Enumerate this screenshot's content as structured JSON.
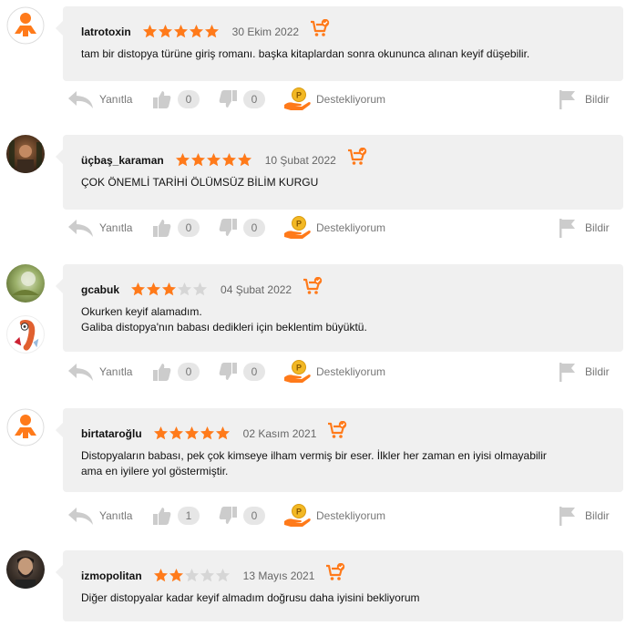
{
  "colors": {
    "accent": "#ff7a1a",
    "bubble": "#f0f0f0",
    "icon_gray": "#cccccc"
  },
  "actions": {
    "reply_label": "Yanıtla",
    "support_label": "Destekliyorum",
    "report_label": "Bildir"
  },
  "reviews": [
    {
      "user": "latrotoxin",
      "rating": 5,
      "date": "30 Ekim 2022",
      "lines": [
        "tam bir distopya türüne giriş romanı. başka kitaplardan sonra okununca alınan keyif düşebilir."
      ],
      "likes": "0",
      "dislikes": "0",
      "avatar": "default-avatar-icon"
    },
    {
      "user": "üçbaş_karaman",
      "rating": 5,
      "date": "10 Şubat 2022",
      "lines": [
        "ÇOK ÖNEMLİ TARİHİ ÖLÜMSÜZ BİLİM KURGU"
      ],
      "likes": "0",
      "dislikes": "0",
      "avatar": "photo-avatar"
    },
    {
      "user": "gcabuk",
      "rating": 3,
      "date": "04 Şubat 2022",
      "lines": [
        "Okurken keyif alamadım.",
        "Galiba distopya'nın babası dedikleri için beklentim büyüktü."
      ],
      "likes": "0",
      "dislikes": "0",
      "avatar": "photo-avatar"
    },
    {
      "user": "birtataroğlu",
      "rating": 5,
      "date": "02 Kasım 2021",
      "lines": [
        "Distopyaların babası, pek çok kimseye ilham vermiş bir eser. İlkler her zaman en iyisi olmayabilir",
        "ama en iyilere yol göstermiştir."
      ],
      "likes": "1",
      "dislikes": "0",
      "avatar": "default-avatar-icon"
    },
    {
      "user": "izmopolitan",
      "rating": 2,
      "date": "13 Mayıs 2021",
      "lines": [
        "Diğer distopyalar kadar keyif almadım doğrusu daha iyisini bekliyorum"
      ],
      "likes": "",
      "dislikes": "",
      "avatar": "photo-avatar"
    }
  ]
}
